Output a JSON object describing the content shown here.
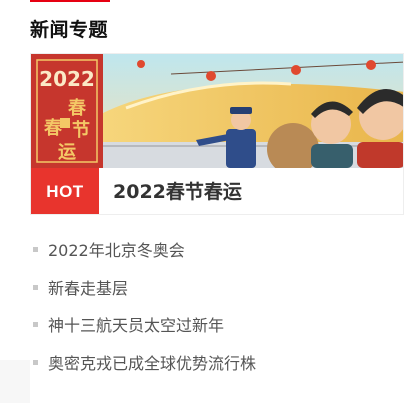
{
  "section": {
    "title": "新闻专题"
  },
  "feature": {
    "badge": "HOT",
    "title": "2022春节春运",
    "banner": {
      "year": "2022",
      "chars": [
        "春",
        "春",
        "节",
        "运"
      ]
    }
  },
  "news": {
    "items": [
      {
        "label": "2022年北京冬奥会"
      },
      {
        "label": "新春走基层"
      },
      {
        "label": "神十三航天员太空过新年"
      },
      {
        "label": "奥密克戎已成全球优势流行株"
      }
    ]
  },
  "colors": {
    "accent": "#e60012",
    "hot_badge": "#e8342d",
    "banner_red": "#c6362d",
    "banner_gold": "#f4c866"
  }
}
